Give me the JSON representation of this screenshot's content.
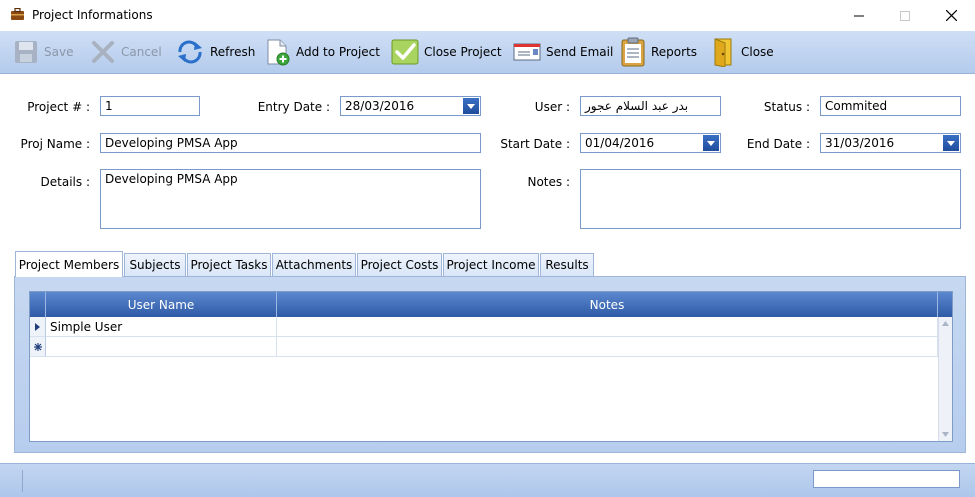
{
  "window": {
    "title": "Project Informations"
  },
  "toolbar": {
    "save": "Save",
    "cancel": "Cancel",
    "refresh": "Refresh",
    "add_to_project": "Add to Project",
    "close_project": "Close Project",
    "send_email": "Send Email",
    "reports": "Reports",
    "close": "Close"
  },
  "form": {
    "project_no_label": "Project # :",
    "project_no": "1",
    "entry_date_label": "Entry Date :",
    "entry_date": "28/03/2016",
    "user_label": "User :",
    "user": "بدر عبد السلام عجور",
    "status_label": "Status :",
    "status": "Commited",
    "proj_name_label": "Proj Name :",
    "proj_name": "Developing PMSA App",
    "start_date_label": "Start Date :",
    "start_date": "01/04/2016",
    "end_date_label": "End Date :",
    "end_date": "31/03/2016",
    "details_label": "Details :",
    "details": "Developing PMSA App",
    "notes_label": "Notes :",
    "notes": ""
  },
  "tabs": [
    "Project Members",
    "Subjects",
    "Project Tasks",
    "Attachments",
    "Project Costs",
    "Project Income",
    "Results"
  ],
  "grid": {
    "columns": [
      "User Name",
      "Notes"
    ],
    "rows": [
      {
        "user_name": "Simple User",
        "notes": ""
      }
    ]
  },
  "colors": {
    "toolbar": "#c4d7f1",
    "grid_header": "#3c68b4",
    "accent_blue": "#2458b3"
  }
}
